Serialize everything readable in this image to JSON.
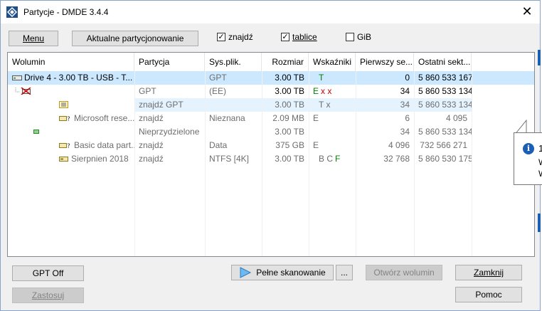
{
  "window": {
    "title": "Partycje - DMDE 3.4.4",
    "close_glyph": "✕"
  },
  "toolbar": {
    "menu_label": "Menu",
    "current_partitioning_label": "Aktualne partycjonowanie",
    "found_label": "znajdź",
    "found_checked": true,
    "tables_label": "tablice",
    "tables_checked": true,
    "gib_label": "GiB",
    "gib_checked": false,
    "check_glyph": "✓"
  },
  "table": {
    "columns": [
      "Wolumin",
      "Partycja",
      "Sys.plik.",
      "Rozmiar",
      "Wskaźniki",
      "Pierwszy se...",
      "Ostatni sekt..."
    ],
    "rows": [
      {
        "volume": "Drive 4 - 3.00 TB - USB - T...",
        "partition": "",
        "fs": "GPT",
        "size": "3.00 TB",
        "flags": "T",
        "first": "0",
        "last": "5 860 533 167"
      },
      {
        "volume": "",
        "partition": "GPT",
        "fs": "(EE)",
        "size": "3.00 TB",
        "flags_e": "E",
        "flags_x": "x x",
        "first": "34",
        "last": "5 860 533 134"
      },
      {
        "volume": "",
        "partition": "znajdź GPT",
        "fs": "",
        "size": "3.00 TB",
        "flags": "T x",
        "first": "34",
        "last": "5 860 533 134"
      },
      {
        "volume": "Microsoft rese...",
        "partition": "znajdź",
        "fs": "Nieznana",
        "size": "2.09 MB",
        "flags": "E",
        "first": "6",
        "last": "4 095"
      },
      {
        "volume": "",
        "partition": "Nieprzydzielone",
        "fs": "",
        "size": "3.00 TB",
        "flags": "",
        "first": "34",
        "last": "5 860 533 134"
      },
      {
        "volume": "Basic data part...",
        "partition": "znajdź",
        "fs": "Data",
        "size": "375 GB",
        "flags": "E",
        "first": "4 096",
        "last": "732 566 271"
      },
      {
        "volume": "Sierpnien 2018",
        "partition": "znajdź",
        "fs": "NTFS [4K]",
        "size": "3.00 TB",
        "flags_bc": "B C",
        "flags_f": "F",
        "first": "32 768",
        "last": "5 860 530 175"
      }
    ]
  },
  "bottom": {
    "gpt_off_label": "GPT Off",
    "apply_label": "Zastosuj",
    "full_scan_label": "Pełne skanowanie",
    "more_label": "...",
    "open_volume_label": "Otwórz wolumin",
    "close_label": "Zamknij",
    "help_label": "Pomoc"
  },
  "tooltip": {
    "line1": "1",
    "line2": "W",
    "line3": "W"
  },
  "colors": {
    "accent": "#0078d7",
    "selected_row": "#cce8ff",
    "flag_green": "#008000",
    "flag_red": "#cc0000"
  }
}
